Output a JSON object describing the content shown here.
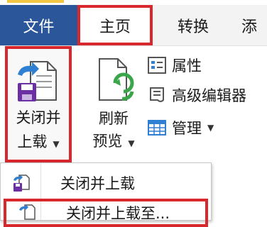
{
  "tabs": [
    {
      "label": "文件"
    },
    {
      "label": "主页"
    },
    {
      "label": "转换"
    },
    {
      "label": "添"
    }
  ],
  "ribbon": {
    "close_load": {
      "line1": "关闭并",
      "line2": "上载"
    },
    "refresh": {
      "line1": "刷新",
      "line2": "预览"
    },
    "properties": "属性",
    "advanced_editor": "高级编辑器",
    "manage": "管理"
  },
  "dropdown": {
    "items": [
      {
        "label": "关闭并上载"
      },
      {
        "label": "关闭并上载至..."
      }
    ]
  },
  "colors": {
    "file_tab": "#2b579a",
    "highlight": "#d8282e",
    "accent_purple": "#6b2fa3",
    "accent_blue": "#2f7fd2",
    "accent_green": "#3aa54a"
  }
}
